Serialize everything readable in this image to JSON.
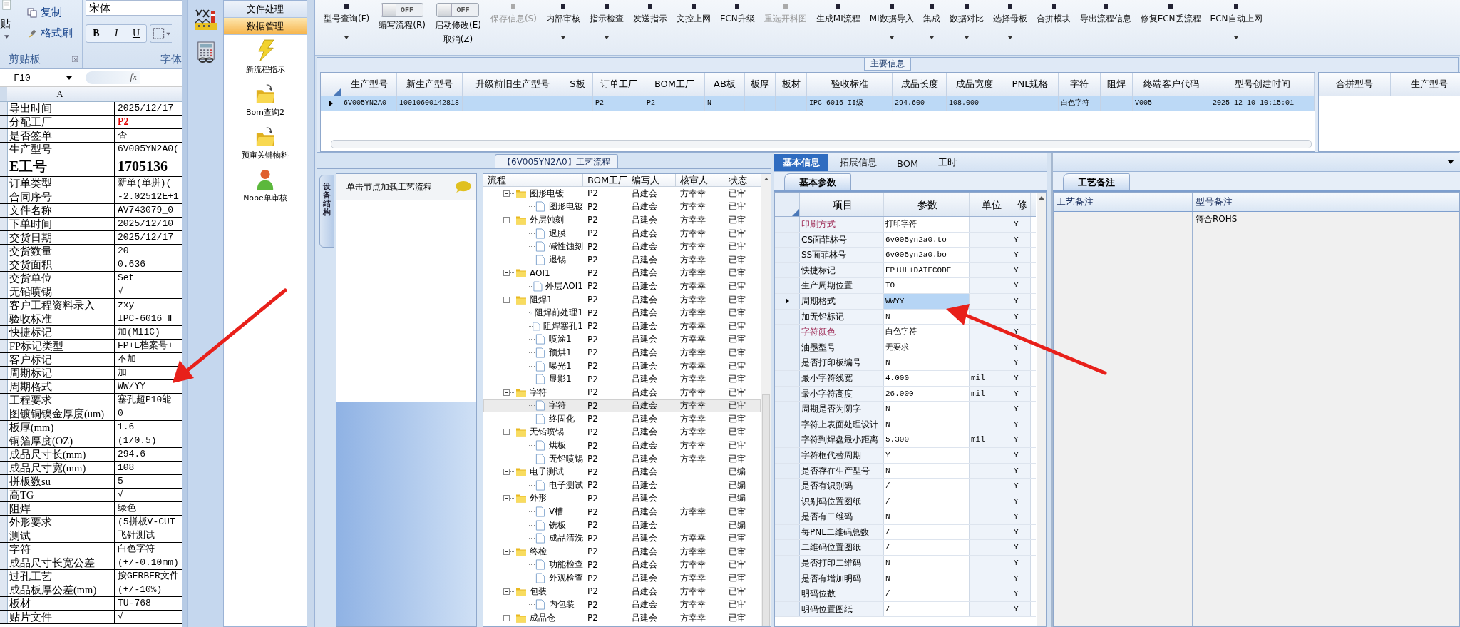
{
  "excel": {
    "ribbon": {
      "paste": "贴",
      "copy": "复制",
      "format_painter": "格式刷",
      "clipboard_group": "剪贴板",
      "font_name": "宋体",
      "bold": "B",
      "italic": "I",
      "underline": "U",
      "font_group": "字体"
    },
    "name_box": "F10",
    "formula_icon": "fx",
    "column_header": "A",
    "rows": [
      {
        "label": "导出时间",
        "value": "2025/12/17",
        "kind": "text"
      },
      {
        "label": "分配工厂",
        "value": "P2",
        "kind": "alert"
      },
      {
        "label": "是否签单",
        "value": "否",
        "kind": "text"
      },
      {
        "label": "生产型号",
        "value": "6V005YN2A0(",
        "kind": "text"
      },
      {
        "label": "E工号",
        "value": "1705136",
        "kind": "heading"
      },
      {
        "label": "订单类型",
        "value": "新单(单拼)(",
        "kind": "text"
      },
      {
        "label": "合同序号",
        "value": "-2.02512E+1",
        "kind": "text"
      },
      {
        "label": "文件名称",
        "value": "AV743079_0",
        "kind": "text"
      },
      {
        "label": "下单时间",
        "value": "2025/12/10",
        "kind": "text"
      },
      {
        "label": "交货日期",
        "value": "2025/12/17",
        "kind": "text"
      },
      {
        "label": "交货数量",
        "value": "20",
        "kind": "text"
      },
      {
        "label": "交货面积",
        "value": "0.636",
        "kind": "text"
      },
      {
        "label": "交货单位",
        "value": "Set",
        "kind": "text"
      },
      {
        "label": "无铅喷锡",
        "value": "√",
        "kind": "text"
      },
      {
        "label": "客户工程资料录入",
        "value": "zxy",
        "kind": "text"
      },
      {
        "label": "验收标准",
        "value": "IPC-6016 Ⅱ",
        "kind": "text"
      },
      {
        "label": "快捷标记",
        "value": "加(M11C)",
        "kind": "text"
      },
      {
        "label": "FP标记类型",
        "value": "FP+E档案号+",
        "kind": "text"
      },
      {
        "label": "客户标记",
        "value": "不加",
        "kind": "text"
      },
      {
        "label": "周期标记",
        "value": "加",
        "kind": "text"
      },
      {
        "label": "周期格式",
        "value": "WW/YY",
        "kind": "text"
      },
      {
        "label": "工程要求",
        "value": "塞孔超P10能",
        "kind": "text"
      },
      {
        "label": "图镀铜镍金厚度(um)",
        "value": "0",
        "kind": "text"
      },
      {
        "label": "板厚(mm)",
        "value": "1.6",
        "kind": "text"
      },
      {
        "label": "铜箔厚度(OZ)",
        "value": "(1/0.5)",
        "kind": "text"
      },
      {
        "label": "成品尺寸长(mm)",
        "value": "294.6",
        "kind": "text"
      },
      {
        "label": "成品尺寸宽(mm)",
        "value": "108",
        "kind": "text"
      },
      {
        "label": "拼板数su",
        "value": "5",
        "kind": "text"
      },
      {
        "label": "高TG",
        "value": "√",
        "kind": "text"
      },
      {
        "label": "阻焊",
        "value": "绿色",
        "kind": "text"
      },
      {
        "label": "外形要求",
        "value": "(5拼板V-CUT",
        "kind": "text"
      },
      {
        "label": "测试",
        "value": "飞针测试",
        "kind": "text"
      },
      {
        "label": "字符",
        "value": "白色字符",
        "kind": "text"
      },
      {
        "label": "成品尺寸长宽公差",
        "value": "(+/-0.10mm)",
        "kind": "text"
      },
      {
        "label": "过孔工艺",
        "value": "按GERBER文件",
        "kind": "text"
      },
      {
        "label": "成品板厚公差(mm)",
        "value": "(+/-10%)",
        "kind": "text"
      },
      {
        "label": "板材",
        "value": "TU-768",
        "kind": "text"
      },
      {
        "label": "贴片文件",
        "value": "√",
        "kind": "text"
      }
    ]
  },
  "nav": {
    "sections": [
      {
        "label": "文件处理",
        "selected": false
      },
      {
        "label": "数据管理",
        "selected": true
      }
    ],
    "items": [
      {
        "label": "新流程指示",
        "kind": "wizard"
      },
      {
        "label": "Bom查询2",
        "kind": "query"
      },
      {
        "label": "预审关键物料",
        "kind": "query"
      },
      {
        "label": "Nope单审核",
        "kind": "review"
      }
    ]
  },
  "toolbar": [
    {
      "kind": "menu",
      "label": "型号查询(F)",
      "disabled": false
    },
    {
      "kind": "toggle",
      "label": "编写流程(R)",
      "switch": "OFF",
      "on": false
    },
    {
      "kind": "toggle",
      "label": "启动修改(E)",
      "sublabel": "取消(Z)",
      "switch": "OFF",
      "on": false
    },
    {
      "kind": "button",
      "label": "保存信息(S)",
      "disabled": true
    },
    {
      "kind": "menu",
      "label": "内部审核",
      "disabled": false
    },
    {
      "kind": "menu",
      "label": "指示检查",
      "disabled": false
    },
    {
      "kind": "button",
      "label": "发送指示",
      "disabled": false
    },
    {
      "kind": "button",
      "label": "文控上网",
      "disabled": false
    },
    {
      "kind": "button",
      "label": "ECN升级",
      "disabled": false
    },
    {
      "kind": "button",
      "label": "重选开料图",
      "disabled": true
    },
    {
      "kind": "button",
      "label": "生成MI流程",
      "disabled": false
    },
    {
      "kind": "menu",
      "label": "MI数据导入",
      "disabled": false
    },
    {
      "kind": "menu",
      "label": "集成",
      "disabled": false
    },
    {
      "kind": "menu",
      "label": "数据对比",
      "disabled": false
    },
    {
      "kind": "menu",
      "label": "选择母板",
      "disabled": false
    },
    {
      "kind": "button",
      "label": "合拼模块",
      "disabled": false
    },
    {
      "kind": "button",
      "label": "导出流程信息",
      "disabled": false
    },
    {
      "kind": "button",
      "label": "修复ECN丢流程",
      "disabled": false
    },
    {
      "kind": "menu",
      "label": "ECN自动上网",
      "disabled": false
    }
  ],
  "main_info": {
    "title": "主要信息",
    "columns": [
      "生产型号",
      "新生产型号",
      "升级前旧生产型号",
      "S板",
      "订单工厂",
      "BOM工厂",
      "AB板",
      "板厚",
      "板材",
      "验收标准",
      "成品长度",
      "成品宽度",
      "PNL规格",
      "字符",
      "阻焊",
      "终端客户代码",
      "型号创建时间"
    ],
    "rows": [
      {
        "selected": true,
        "cells": [
          "6V005YN2A0",
          "10010600142818",
          "",
          "",
          "P2",
          "P2",
          "N",
          "",
          "",
          "IPC-6016 II级",
          "294.600",
          "108.000",
          "",
          "白色字符",
          "",
          "V005",
          "2025-12-10 10:15:01"
        ]
      }
    ],
    "side_columns": [
      "合拼型号",
      "生产型号"
    ]
  },
  "process": {
    "title": "【6V005YN2A0】工艺流程",
    "side_tab": "设备结构",
    "hint": "单击节点加载工艺流程",
    "columns": [
      "流程",
      "BOM工厂",
      "编写人",
      "核审人",
      "状态"
    ],
    "rows": [
      {
        "name": "图形电镀",
        "bom": "P2",
        "writer": "吕建会",
        "reviewer": "方幸幸",
        "status": "已审",
        "selected": false,
        "expanded": true,
        "children": [
          {
            "name": "图形电镀",
            "bom": "P2",
            "writer": "吕建会",
            "reviewer": "方幸幸",
            "status": "已审",
            "selected": false
          }
        ]
      },
      {
        "name": "外层蚀刻",
        "bom": "P2",
        "writer": "吕建会",
        "reviewer": "方幸幸",
        "status": "已审",
        "selected": false,
        "expanded": true,
        "children": [
          {
            "name": "退膜",
            "bom": "P2",
            "writer": "吕建会",
            "reviewer": "方幸幸",
            "status": "已审",
            "selected": false
          },
          {
            "name": "碱性蚀刻",
            "bom": "P2",
            "writer": "吕建会",
            "reviewer": "方幸幸",
            "status": "已审",
            "selected": false
          },
          {
            "name": "退锡",
            "bom": "P2",
            "writer": "吕建会",
            "reviewer": "方幸幸",
            "status": "已审",
            "selected": false
          }
        ]
      },
      {
        "name": "AOI1",
        "bom": "P2",
        "writer": "吕建会",
        "reviewer": "方幸幸",
        "status": "已审",
        "selected": false,
        "expanded": true,
        "children": [
          {
            "name": "外层AOI1",
            "bom": "P2",
            "writer": "吕建会",
            "reviewer": "方幸幸",
            "status": "已审",
            "selected": false
          }
        ]
      },
      {
        "name": "阻焊1",
        "bom": "P2",
        "writer": "吕建会",
        "reviewer": "方幸幸",
        "status": "已审",
        "selected": false,
        "expanded": true,
        "children": [
          {
            "name": "阻焊前处理1",
            "bom": "P2",
            "writer": "吕建会",
            "reviewer": "方幸幸",
            "status": "已审",
            "selected": false
          },
          {
            "name": "阻焊塞孔1",
            "bom": "P2",
            "writer": "吕建会",
            "reviewer": "方幸幸",
            "status": "已审",
            "selected": false
          },
          {
            "name": "喷涂1",
            "bom": "P2",
            "writer": "吕建会",
            "reviewer": "方幸幸",
            "status": "已审",
            "selected": false
          },
          {
            "name": "预烘1",
            "bom": "P2",
            "writer": "吕建会",
            "reviewer": "方幸幸",
            "status": "已审",
            "selected": false
          },
          {
            "name": "曝光1",
            "bom": "P2",
            "writer": "吕建会",
            "reviewer": "方幸幸",
            "status": "已审",
            "selected": false
          },
          {
            "name": "显影1",
            "bom": "P2",
            "writer": "吕建会",
            "reviewer": "方幸幸",
            "status": "已审",
            "selected": false
          }
        ]
      },
      {
        "name": "字符",
        "bom": "P2",
        "writer": "吕建会",
        "reviewer": "方幸幸",
        "status": "已审",
        "selected": false,
        "expanded": true,
        "children": [
          {
            "name": "字符",
            "bom": "P2",
            "writer": "吕建会",
            "reviewer": "方幸幸",
            "status": "已审",
            "selected": true
          },
          {
            "name": "终固化",
            "bom": "P2",
            "writer": "吕建会",
            "reviewer": "方幸幸",
            "status": "已审",
            "selected": false
          }
        ]
      },
      {
        "name": "无铅喷锡",
        "bom": "P2",
        "writer": "吕建会",
        "reviewer": "方幸幸",
        "status": "已审",
        "selected": false,
        "expanded": true,
        "children": [
          {
            "name": "烘板",
            "bom": "P2",
            "writer": "吕建会",
            "reviewer": "方幸幸",
            "status": "已审",
            "selected": false
          },
          {
            "name": "无铅喷锡",
            "bom": "P2",
            "writer": "吕建会",
            "reviewer": "方幸幸",
            "status": "已审",
            "selected": false
          }
        ]
      },
      {
        "name": "电子测试",
        "bom": "P2",
        "writer": "吕建会",
        "status": "已编",
        "selected": false,
        "expanded": true,
        "children": [
          {
            "name": "电子测试",
            "bom": "P2",
            "writer": "吕建会",
            "status": "已编",
            "selected": false
          }
        ]
      },
      {
        "name": "外形",
        "bom": "P2",
        "writer": "吕建会",
        "status": "已编",
        "selected": false,
        "expanded": true,
        "children": [
          {
            "name": "V槽",
            "bom": "P2",
            "writer": "吕建会",
            "reviewer": "方幸幸",
            "status": "已审",
            "selected": false
          },
          {
            "name": "铣板",
            "bom": "P2",
            "writer": "吕建会",
            "status": "已编",
            "selected": false
          },
          {
            "name": "成品清洗",
            "bom": "P2",
            "writer": "吕建会",
            "reviewer": "方幸幸",
            "status": "已审",
            "selected": false
          }
        ]
      },
      {
        "name": "终检",
        "bom": "P2",
        "writer": "吕建会",
        "reviewer": "方幸幸",
        "status": "已审",
        "selected": false,
        "expanded": true,
        "children": [
          {
            "name": "功能检查",
            "bom": "P2",
            "writer": "吕建会",
            "reviewer": "方幸幸",
            "status": "已审",
            "selected": false
          },
          {
            "name": "外观检查",
            "bom": "P2",
            "writer": "吕建会",
            "reviewer": "方幸幸",
            "status": "已审",
            "selected": false
          }
        ]
      },
      {
        "name": "包装",
        "bom": "P2",
        "writer": "吕建会",
        "reviewer": "方幸幸",
        "status": "已审",
        "selected": false,
        "expanded": true,
        "children": [
          {
            "name": "内包装",
            "bom": "P2",
            "writer": "吕建会",
            "reviewer": "方幸幸",
            "status": "已审",
            "selected": false
          }
        ]
      },
      {
        "name": "成品仓",
        "bom": "P2",
        "writer": "吕建会",
        "reviewer": "方幸幸",
        "status": "已审",
        "selected": false,
        "expanded": true
      }
    ]
  },
  "info": {
    "tabs": [
      {
        "label": "基本信息",
        "selected": true
      },
      {
        "label": "拓展信息",
        "selected": false
      },
      {
        "label": "BOM",
        "selected": false
      },
      {
        "label": "工时",
        "selected": false
      }
    ],
    "subtab": "基本参数",
    "columns": [
      "项目",
      "参数",
      "单位",
      "修"
    ],
    "rows": [
      {
        "item": "印刷方式",
        "value": "打印字符",
        "edit": "Y",
        "highlighted": true,
        "selected": false
      },
      {
        "item": "CS面菲林号",
        "value": "6v005yn2a0.to",
        "edit": "Y",
        "highlighted": false,
        "selected": false
      },
      {
        "item": "SS面菲林号",
        "value": "6v005yn2a0.bo",
        "edit": "Y",
        "highlighted": false,
        "selected": false
      },
      {
        "item": "快捷标记",
        "value": "FP+UL+DATECODE",
        "edit": "Y",
        "highlighted": false,
        "selected": false
      },
      {
        "item": "生产周期位置",
        "value": "TO",
        "edit": "Y",
        "highlighted": false,
        "selected": false
      },
      {
        "item": "周期格式",
        "value": "WWYY",
        "edit": "Y",
        "highlighted": false,
        "selected": true
      },
      {
        "item": "加无铅标记",
        "value": "N",
        "edit": "Y",
        "highlighted": false,
        "selected": false
      },
      {
        "item": "字符颜色",
        "value": "白色字符",
        "edit": "Y",
        "highlighted": true,
        "selected": false
      },
      {
        "item": "油墨型号",
        "value": "无要求",
        "edit": "Y",
        "highlighted": false,
        "selected": false
      },
      {
        "item": "是否打印板编号",
        "value": "N",
        "edit": "Y",
        "highlighted": false,
        "selected": false
      },
      {
        "item": "最小字符线宽",
        "value": "4.000",
        "unit": "mil",
        "edit": "Y",
        "highlighted": false,
        "selected": false
      },
      {
        "item": "最小字符高度",
        "value": "26.000",
        "unit": "mil",
        "edit": "Y",
        "highlighted": false,
        "selected": false
      },
      {
        "item": "周期是否为阴字",
        "value": "N",
        "edit": "Y",
        "highlighted": false,
        "selected": false
      },
      {
        "item": "字符上表面处理设计",
        "value": "N",
        "edit": "Y",
        "highlighted": false,
        "selected": false
      },
      {
        "item": "字符到焊盘最小距离",
        "value": "5.300",
        "unit": "mil",
        "edit": "Y",
        "highlighted": false,
        "selected": false
      },
      {
        "item": "字符框代替周期",
        "value": "Y",
        "edit": "Y",
        "highlighted": false,
        "selected": false
      },
      {
        "item": "是否存在生产型号",
        "value": "N",
        "edit": "Y",
        "highlighted": false,
        "selected": false
      },
      {
        "item": "是否有识别码",
        "value": "/",
        "edit": "Y",
        "highlighted": false,
        "selected": false
      },
      {
        "item": "识别码位置图纸",
        "value": "/",
        "edit": "Y",
        "highlighted": false,
        "selected": false
      },
      {
        "item": "是否有二维码",
        "value": "N",
        "edit": "Y",
        "highlighted": false,
        "selected": false
      },
      {
        "item": "每PNL二维码总数",
        "value": "/",
        "edit": "Y",
        "highlighted": false,
        "selected": false
      },
      {
        "item": "二维码位置图纸",
        "value": "/",
        "edit": "Y",
        "highlighted": false,
        "selected": false
      },
      {
        "item": "是否打印二维码",
        "value": "N",
        "edit": "Y",
        "highlighted": false,
        "selected": false
      },
      {
        "item": "是否有增加明码",
        "value": "N",
        "edit": "Y",
        "highlighted": false,
        "selected": false
      },
      {
        "item": "明码位数",
        "value": "/",
        "edit": "Y",
        "highlighted": false,
        "selected": false
      },
      {
        "item": "明码位置图纸",
        "value": "/",
        "edit": "Y",
        "highlighted": false,
        "selected": false
      }
    ]
  },
  "remarks": {
    "tab": "工艺备注",
    "columns": [
      "工艺备注",
      "型号备注"
    ],
    "model_note": "符合ROHS"
  }
}
